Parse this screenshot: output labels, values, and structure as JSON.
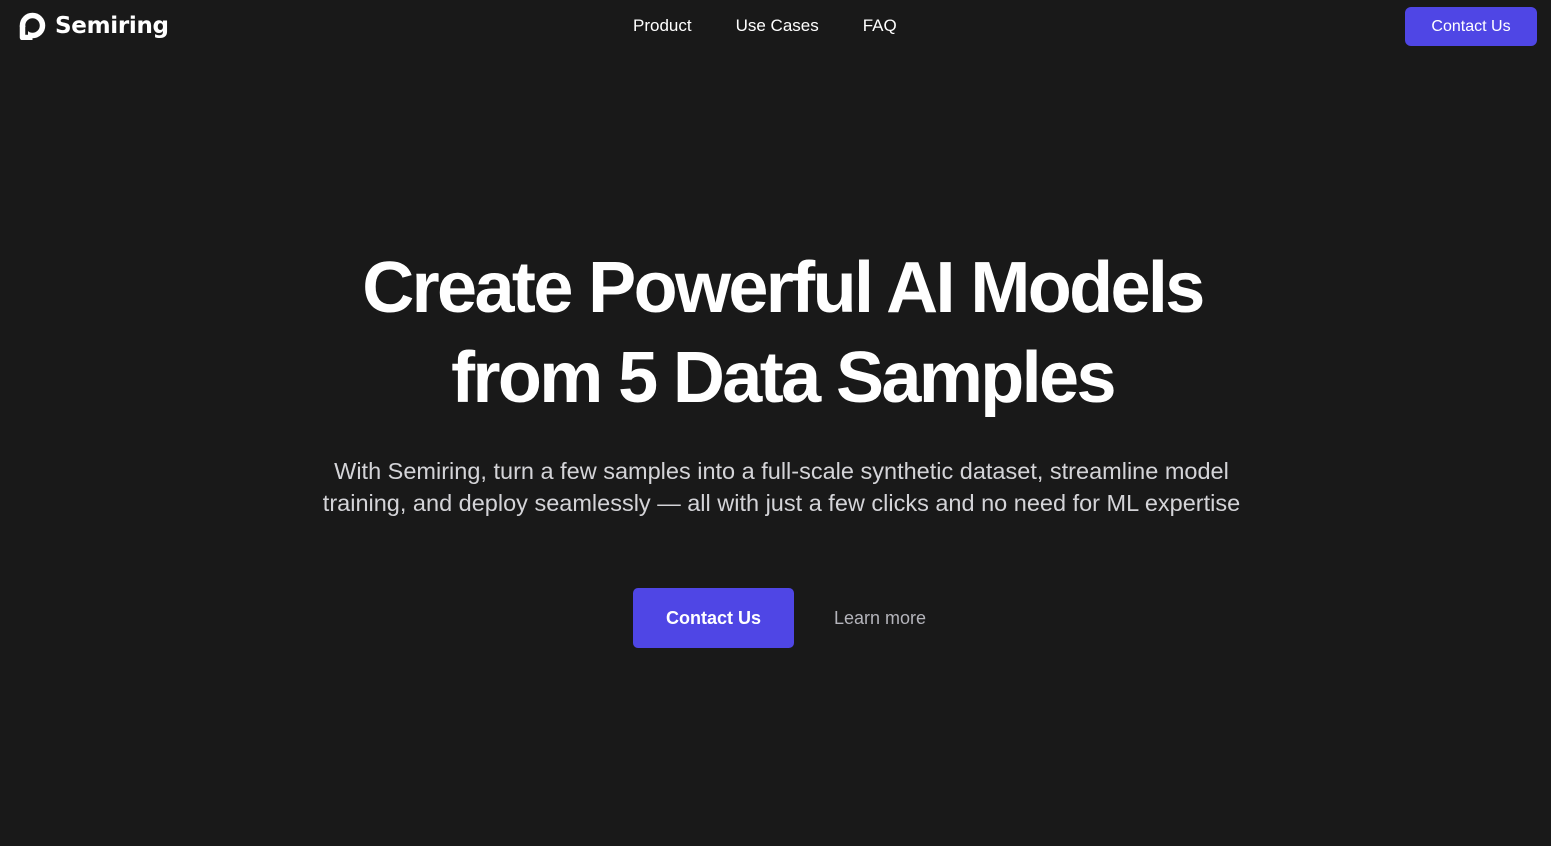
{
  "header": {
    "brand": "Semiring",
    "nav": [
      {
        "label": "Product"
      },
      {
        "label": "Use Cases"
      },
      {
        "label": "FAQ"
      }
    ],
    "cta_label": "Contact Us"
  },
  "hero": {
    "title_line1": "Create Powerful AI Models",
    "title_line2": "from 5 Data Samples",
    "subtitle_line1": "With Semiring, turn a few samples into a full-scale synthetic dataset, streamline model",
    "subtitle_line2": "training, and deploy seamlessly — all with just a few clicks and no need for ML expertise",
    "primary_cta": "Contact Us",
    "secondary_link": "Learn more"
  },
  "colors": {
    "background": "#191919",
    "accent": "#4f46e5",
    "text": "#ffffff",
    "muted_text": "#d4d4d8"
  },
  "icons": {
    "logo": "semiring-ring-logo-icon"
  }
}
